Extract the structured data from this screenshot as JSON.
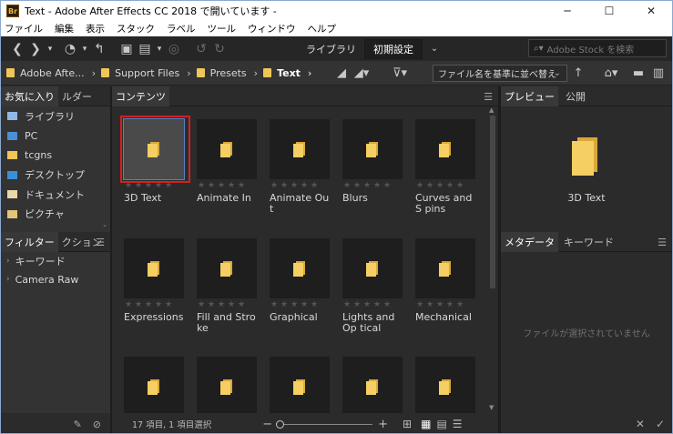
{
  "window": {
    "title": "Text - Adobe After Effects CC 2018 で開いています -",
    "app_icon": "Br",
    "min": "─",
    "max": "☐",
    "close": "✕"
  },
  "menu": [
    "ファイル",
    "編集",
    "表示",
    "スタック",
    "ラベル",
    "ツール",
    "ウィンドウ",
    "ヘルプ"
  ],
  "toolbar": {
    "workspaces": [
      "ライブラリ",
      "初期設定"
    ],
    "active_workspace": "初期設定",
    "search_placeholder": "Adobe Stock を検索"
  },
  "path": {
    "crumbs": [
      "Adobe Afte...",
      "Support Files",
      "Presets",
      "Text"
    ],
    "sort_label": "ファイル名を基準に並べ替え"
  },
  "left_panel": {
    "tabs": [
      "お気に入り",
      "ルダー"
    ],
    "favorites": [
      {
        "label": "ライブラリ",
        "icon": "library-icon"
      },
      {
        "label": "PC",
        "icon": "pc-icon"
      },
      {
        "label": "tcgns",
        "icon": "user-folder-icon"
      },
      {
        "label": "デスクトップ",
        "icon": "desktop-icon"
      },
      {
        "label": "ドキュメント",
        "icon": "documents-icon"
      },
      {
        "label": "ピクチャ",
        "icon": "pictures-icon"
      }
    ],
    "filter_tabs": [
      "フィルター",
      "クション"
    ],
    "filters": [
      "キーワード",
      "Camera Raw"
    ]
  },
  "content": {
    "tab": "コンテンツ",
    "items": [
      {
        "label": "3D Text",
        "selected": true
      },
      {
        "label": "Animate In"
      },
      {
        "label": "Animate Out"
      },
      {
        "label": "Blurs"
      },
      {
        "label": "Curves and S pins"
      },
      {
        "label": "Expressions"
      },
      {
        "label": "Fill and Stroke"
      },
      {
        "label": "Graphical"
      },
      {
        "label": "Lights and Op tical"
      },
      {
        "label": "Mechanical"
      },
      {
        "label": ""
      },
      {
        "label": ""
      },
      {
        "label": ""
      },
      {
        "label": ""
      },
      {
        "label": ""
      }
    ],
    "status": "17 項目, 1 項目選択"
  },
  "right_panel": {
    "tabs": [
      "プレビュー",
      "公開"
    ],
    "preview_label": "3D Text",
    "meta_tabs": [
      "メタデータ",
      "キーワード"
    ],
    "meta_empty": "ファイルが選択されていません"
  },
  "colors": {
    "selection": "#d42020",
    "folder": "#f5cf63",
    "background": "#2b2b2b"
  }
}
